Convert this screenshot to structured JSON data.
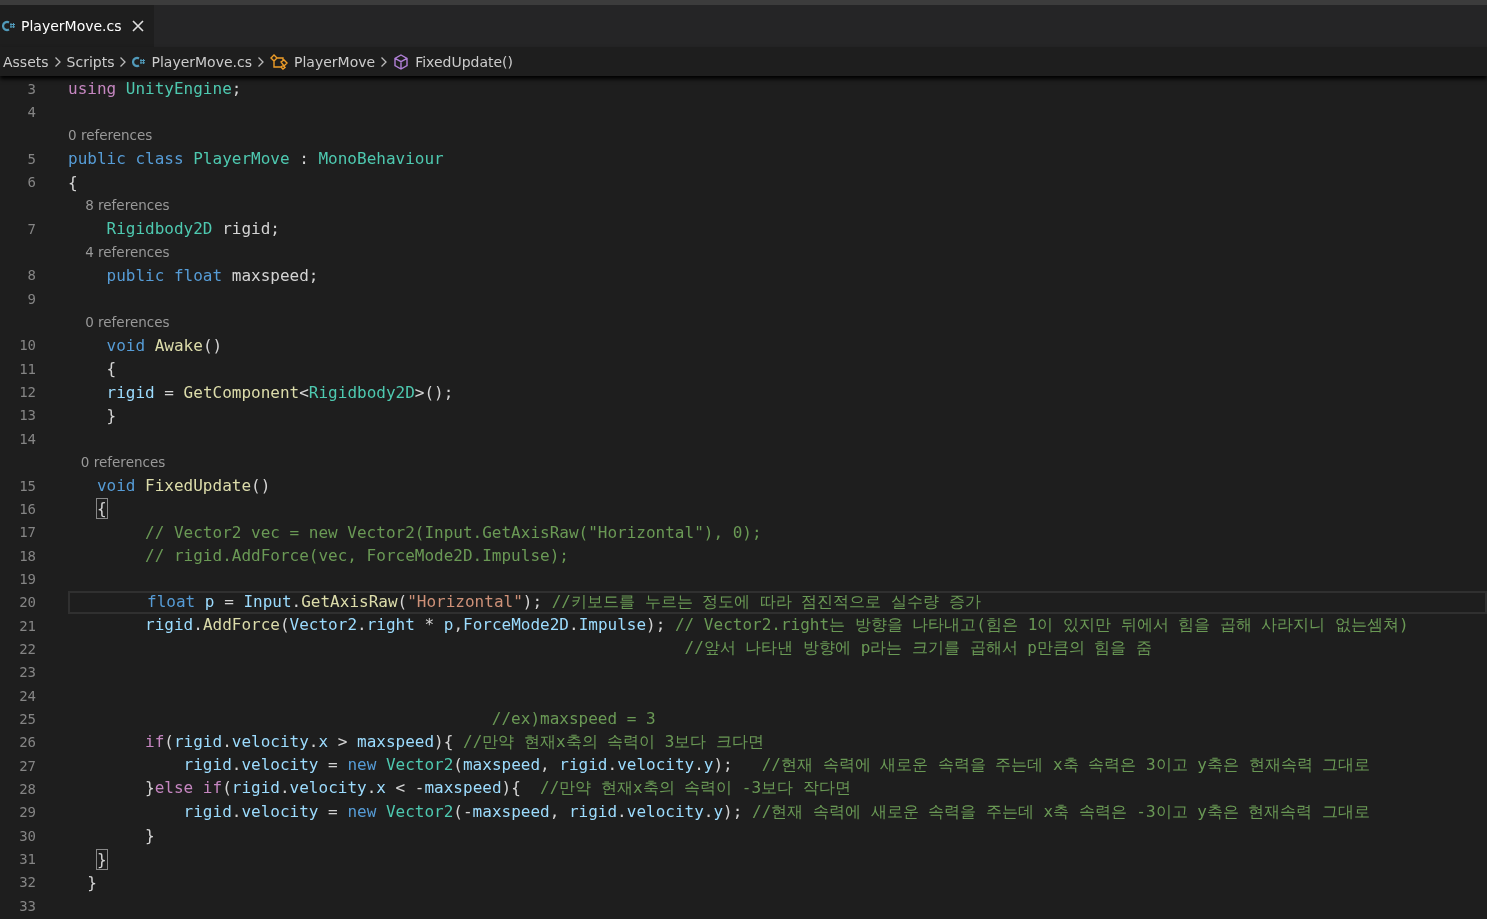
{
  "tab": {
    "label": "PlayerMove.cs",
    "selected": true
  },
  "breadcrumbs": [
    {
      "label": "Assets",
      "kind": "folder"
    },
    {
      "label": "Scripts",
      "kind": "folder"
    },
    {
      "label": "PlayerMove.cs",
      "kind": "file"
    },
    {
      "label": "PlayerMove",
      "kind": "class"
    },
    {
      "label": "FixedUpdate()",
      "kind": "method"
    }
  ],
  "lines": [
    {
      "number": "3",
      "current": false,
      "tokens": [
        {
          "text": "using ",
          "kind": "ctrl"
        },
        {
          "text": "UnityEngine",
          "kind": "type"
        },
        {
          "text": ";",
          "kind": "plain"
        }
      ]
    },
    {
      "number": "4",
      "current": false
    },
    {
      "number": "5",
      "current": false,
      "lens": "0 references",
      "tokens": [
        {
          "text": "public class ",
          "kind": "kw"
        },
        {
          "text": "PlayerMove",
          "kind": "type"
        },
        {
          "text": " : ",
          "kind": "plain"
        },
        {
          "text": "MonoBehaviour",
          "kind": "type"
        }
      ]
    },
    {
      "number": "6",
      "current": false,
      "tokens": [
        {
          "text": "{",
          "kind": "plain"
        }
      ]
    },
    {
      "number": "7",
      "current": false,
      "lens": "    8 references",
      "tokens": [
        {
          "text": "    Rigidbody2D",
          "kind": "type"
        },
        {
          "text": " rigid;",
          "kind": "plain"
        }
      ]
    },
    {
      "number": "8",
      "current": false,
      "lens": "    4 references",
      "tokens": [
        {
          "text": "    public float",
          "kind": "kw"
        },
        {
          "text": " maxspeed;",
          "kind": "plain"
        }
      ]
    },
    {
      "number": "9",
      "current": false
    },
    {
      "number": "10",
      "current": false,
      "lens": "    0 references",
      "tokens": [
        {
          "text": "    void ",
          "kind": "kw"
        },
        {
          "text": "Awake",
          "kind": "fn"
        },
        {
          "text": "()",
          "kind": "plain"
        }
      ]
    },
    {
      "number": "11",
      "current": false,
      "tokens": [
        {
          "text": "    {",
          "kind": "plain"
        }
      ]
    },
    {
      "number": "12",
      "current": false,
      "tokens": [
        {
          "text": "    rigid",
          "kind": "var"
        },
        {
          "text": " = ",
          "kind": "plain"
        },
        {
          "text": "GetComponent",
          "kind": "fn"
        },
        {
          "text": "<",
          "kind": "plain"
        },
        {
          "text": "Rigidbody2D",
          "kind": "type"
        },
        {
          "text": ">();",
          "kind": "plain"
        }
      ]
    },
    {
      "number": "13",
      "current": false,
      "tokens": [
        {
          "text": "    }",
          "kind": "plain"
        }
      ]
    },
    {
      "number": "14",
      "current": false
    },
    {
      "number": "15",
      "current": false,
      "lens": "   0 references",
      "tokens": [
        {
          "text": "   void ",
          "kind": "kw"
        },
        {
          "text": "FixedUpdate",
          "kind": "fn"
        },
        {
          "text": "()",
          "kind": "plain"
        }
      ]
    },
    {
      "number": "16",
      "current": false,
      "tokens": [
        {
          "text": "   {",
          "kind": "bracket"
        }
      ]
    },
    {
      "number": "17",
      "current": false,
      "tokens": [
        {
          "text": "        // Vector2 vec = new Vector2(Input.GetAxisRaw(\"Horizontal\"), 0);",
          "kind": "cm"
        }
      ]
    },
    {
      "number": "18",
      "current": false,
      "tokens": [
        {
          "text": "        // rigid.AddForce(vec, ForceMode2D.Impulse);",
          "kind": "cm"
        }
      ]
    },
    {
      "number": "19",
      "current": false
    },
    {
      "number": "20",
      "current": true,
      "tokens": [
        {
          "text": "        float ",
          "kind": "kw"
        },
        {
          "text": "p",
          "kind": "var"
        },
        {
          "text": " = ",
          "kind": "plain"
        },
        {
          "text": "Input",
          "kind": "var"
        },
        {
          "text": ".",
          "kind": "plain"
        },
        {
          "text": "GetAxisRaw",
          "kind": "fn"
        },
        {
          "text": "(",
          "kind": "plain"
        },
        {
          "text": "\"Horizontal\"",
          "kind": "str"
        },
        {
          "text": "); ",
          "kind": "plain"
        },
        {
          "text": "//키보드를 누르는 정도에 따라 점진적으로 실수량 증가",
          "kind": "cm"
        }
      ]
    },
    {
      "number": "21",
      "current": false,
      "tokens": [
        {
          "text": "        rigid",
          "kind": "var"
        },
        {
          "text": ".",
          "kind": "plain"
        },
        {
          "text": "AddForce",
          "kind": "fn"
        },
        {
          "text": "(",
          "kind": "plain"
        },
        {
          "text": "Vector2",
          "kind": "var"
        },
        {
          "text": ".",
          "kind": "plain"
        },
        {
          "text": "right",
          "kind": "var"
        },
        {
          "text": " * ",
          "kind": "plain"
        },
        {
          "text": "p",
          "kind": "var"
        },
        {
          "text": ",",
          "kind": "plain"
        },
        {
          "text": "ForceMode2D",
          "kind": "var"
        },
        {
          "text": ".",
          "kind": "plain"
        },
        {
          "text": "Impulse",
          "kind": "var"
        },
        {
          "text": "); ",
          "kind": "plain"
        },
        {
          "text": "// Vector2.right는 방향을 나타내고(힘은 1이 있지만 뒤에서 힘을 곱해 사라지니 없는셈쳐)",
          "kind": "cm"
        }
      ]
    },
    {
      "number": "22",
      "current": false,
      "tokens": [
        {
          "text": "                                                                //앞서 나타낸 방향에 p라는 크기를 곱해서 p만큼의 힘을 줌",
          "kind": "cm"
        }
      ]
    },
    {
      "number": "23",
      "current": false
    },
    {
      "number": "24",
      "current": false
    },
    {
      "number": "25",
      "current": false,
      "tokens": [
        {
          "text": "                                            //ex)maxspeed = 3",
          "kind": "cm"
        }
      ]
    },
    {
      "number": "26",
      "current": false,
      "tokens": [
        {
          "text": "        if",
          "kind": "ctrl"
        },
        {
          "text": "(",
          "kind": "plain"
        },
        {
          "text": "rigid",
          "kind": "var"
        },
        {
          "text": ".",
          "kind": "plain"
        },
        {
          "text": "velocity",
          "kind": "var"
        },
        {
          "text": ".",
          "kind": "plain"
        },
        {
          "text": "x",
          "kind": "var"
        },
        {
          "text": " > ",
          "kind": "plain"
        },
        {
          "text": "maxspeed",
          "kind": "var"
        },
        {
          "text": "){ ",
          "kind": "plain"
        },
        {
          "text": "//만약 현재x축의 속력이 3보다 크다면",
          "kind": "cm"
        }
      ]
    },
    {
      "number": "27",
      "current": false,
      "tokens": [
        {
          "text": "            rigid",
          "kind": "var"
        },
        {
          "text": ".",
          "kind": "plain"
        },
        {
          "text": "velocity",
          "kind": "var"
        },
        {
          "text": " = ",
          "kind": "plain"
        },
        {
          "text": "new ",
          "kind": "kw"
        },
        {
          "text": "Vector2",
          "kind": "type"
        },
        {
          "text": "(",
          "kind": "plain"
        },
        {
          "text": "maxspeed",
          "kind": "var"
        },
        {
          "text": ", ",
          "kind": "plain"
        },
        {
          "text": "rigid",
          "kind": "var"
        },
        {
          "text": ".",
          "kind": "plain"
        },
        {
          "text": "velocity",
          "kind": "var"
        },
        {
          "text": ".",
          "kind": "plain"
        },
        {
          "text": "y",
          "kind": "var"
        },
        {
          "text": ");   ",
          "kind": "plain"
        },
        {
          "text": "//현재 속력에 새로운 속력을 주는데 x축 속력은 3이고 y축은 현재속력 그대로",
          "kind": "cm"
        }
      ]
    },
    {
      "number": "28",
      "current": false,
      "tokens": [
        {
          "text": "        }",
          "kind": "plain"
        },
        {
          "text": "else if",
          "kind": "ctrl"
        },
        {
          "text": "(",
          "kind": "plain"
        },
        {
          "text": "rigid",
          "kind": "var"
        },
        {
          "text": ".",
          "kind": "plain"
        },
        {
          "text": "velocity",
          "kind": "var"
        },
        {
          "text": ".",
          "kind": "plain"
        },
        {
          "text": "x",
          "kind": "var"
        },
        {
          "text": " < -",
          "kind": "plain"
        },
        {
          "text": "maxspeed",
          "kind": "var"
        },
        {
          "text": "){  ",
          "kind": "plain"
        },
        {
          "text": "//만약 현재x축의 속력이 -3보다 작다면",
          "kind": "cm"
        }
      ]
    },
    {
      "number": "29",
      "current": false,
      "tokens": [
        {
          "text": "            rigid",
          "kind": "var"
        },
        {
          "text": ".",
          "kind": "plain"
        },
        {
          "text": "velocity",
          "kind": "var"
        },
        {
          "text": " = ",
          "kind": "plain"
        },
        {
          "text": "new ",
          "kind": "kw"
        },
        {
          "text": "Vector2",
          "kind": "type"
        },
        {
          "text": "(-",
          "kind": "plain"
        },
        {
          "text": "maxspeed",
          "kind": "var"
        },
        {
          "text": ", ",
          "kind": "plain"
        },
        {
          "text": "rigid",
          "kind": "var"
        },
        {
          "text": ".",
          "kind": "plain"
        },
        {
          "text": "velocity",
          "kind": "var"
        },
        {
          "text": ".",
          "kind": "plain"
        },
        {
          "text": "y",
          "kind": "var"
        },
        {
          "text": "); ",
          "kind": "plain"
        },
        {
          "text": "//현재 속력에 새로운 속력을 주는데 x축 속력은 -3이고 y축은 현재속력 그대로",
          "kind": "cm"
        }
      ]
    },
    {
      "number": "30",
      "current": false,
      "tokens": [
        {
          "text": "        }",
          "kind": "plain"
        }
      ]
    },
    {
      "number": "31",
      "current": false,
      "tokens": [
        {
          "text": "   }",
          "kind": "bracket"
        }
      ]
    },
    {
      "number": "32",
      "current": false,
      "tokens": [
        {
          "text": "  }",
          "kind": "plain"
        }
      ]
    },
    {
      "number": "33",
      "current": false
    }
  ]
}
